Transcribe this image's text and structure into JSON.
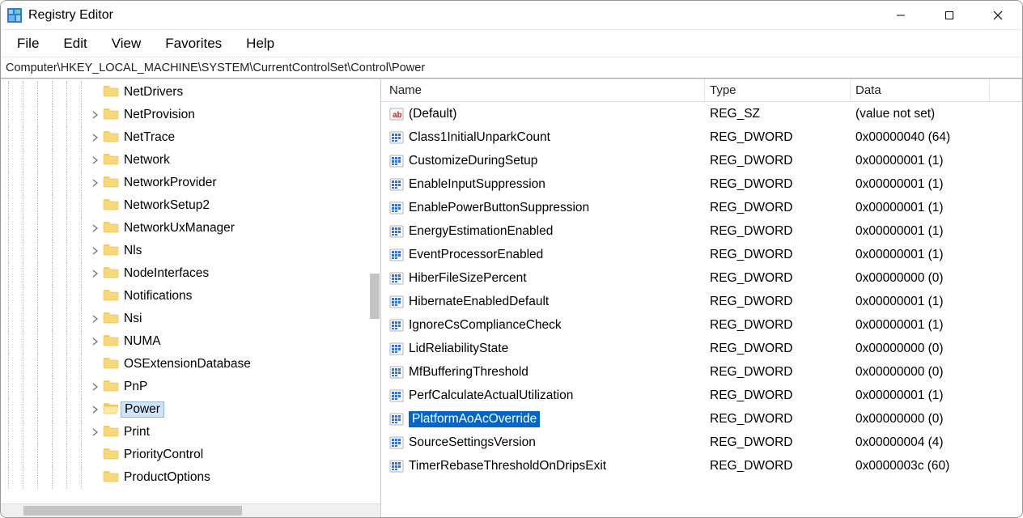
{
  "window": {
    "title": "Registry Editor"
  },
  "menu": {
    "items": [
      "File",
      "Edit",
      "View",
      "Favorites",
      "Help"
    ]
  },
  "address": "Computer\\HKEY_LOCAL_MACHINE\\SYSTEM\\CurrentControlSet\\Control\\Power",
  "columns": {
    "name": "Name",
    "type": "Type",
    "data": "Data"
  },
  "tree": [
    {
      "label": "NetDrivers",
      "depth": 7,
      "expandable": false,
      "selected": false
    },
    {
      "label": "NetProvision",
      "depth": 7,
      "expandable": true,
      "selected": false
    },
    {
      "label": "NetTrace",
      "depth": 7,
      "expandable": true,
      "selected": false
    },
    {
      "label": "Network",
      "depth": 7,
      "expandable": true,
      "selected": false
    },
    {
      "label": "NetworkProvider",
      "depth": 7,
      "expandable": true,
      "selected": false
    },
    {
      "label": "NetworkSetup2",
      "depth": 7,
      "expandable": false,
      "selected": false
    },
    {
      "label": "NetworkUxManager",
      "depth": 7,
      "expandable": true,
      "selected": false
    },
    {
      "label": "Nls",
      "depth": 7,
      "expandable": true,
      "selected": false
    },
    {
      "label": "NodeInterfaces",
      "depth": 7,
      "expandable": true,
      "selected": false
    },
    {
      "label": "Notifications",
      "depth": 7,
      "expandable": false,
      "selected": false
    },
    {
      "label": "Nsi",
      "depth": 7,
      "expandable": true,
      "selected": false
    },
    {
      "label": "NUMA",
      "depth": 7,
      "expandable": true,
      "selected": false
    },
    {
      "label": "OSExtensionDatabase",
      "depth": 7,
      "expandable": false,
      "selected": false
    },
    {
      "label": "PnP",
      "depth": 7,
      "expandable": true,
      "selected": false
    },
    {
      "label": "Power",
      "depth": 7,
      "expandable": true,
      "selected": true
    },
    {
      "label": "Print",
      "depth": 7,
      "expandable": true,
      "selected": false
    },
    {
      "label": "PriorityControl",
      "depth": 7,
      "expandable": false,
      "selected": false
    },
    {
      "label": "ProductOptions",
      "depth": 7,
      "expandable": false,
      "selected": false
    }
  ],
  "values": [
    {
      "name": "(Default)",
      "type": "REG_SZ",
      "data": "(value not set)",
      "kind": "sz",
      "selected": false
    },
    {
      "name": "Class1InitialUnparkCount",
      "type": "REG_DWORD",
      "data": "0x00000040 (64)",
      "kind": "dword",
      "selected": false
    },
    {
      "name": "CustomizeDuringSetup",
      "type": "REG_DWORD",
      "data": "0x00000001 (1)",
      "kind": "dword",
      "selected": false
    },
    {
      "name": "EnableInputSuppression",
      "type": "REG_DWORD",
      "data": "0x00000001 (1)",
      "kind": "dword",
      "selected": false
    },
    {
      "name": "EnablePowerButtonSuppression",
      "type": "REG_DWORD",
      "data": "0x00000001 (1)",
      "kind": "dword",
      "selected": false
    },
    {
      "name": "EnergyEstimationEnabled",
      "type": "REG_DWORD",
      "data": "0x00000001 (1)",
      "kind": "dword",
      "selected": false
    },
    {
      "name": "EventProcessorEnabled",
      "type": "REG_DWORD",
      "data": "0x00000001 (1)",
      "kind": "dword",
      "selected": false
    },
    {
      "name": "HiberFileSizePercent",
      "type": "REG_DWORD",
      "data": "0x00000000 (0)",
      "kind": "dword",
      "selected": false
    },
    {
      "name": "HibernateEnabledDefault",
      "type": "REG_DWORD",
      "data": "0x00000001 (1)",
      "kind": "dword",
      "selected": false
    },
    {
      "name": "IgnoreCsComplianceCheck",
      "type": "REG_DWORD",
      "data": "0x00000001 (1)",
      "kind": "dword",
      "selected": false
    },
    {
      "name": "LidReliabilityState",
      "type": "REG_DWORD",
      "data": "0x00000000 (0)",
      "kind": "dword",
      "selected": false
    },
    {
      "name": "MfBufferingThreshold",
      "type": "REG_DWORD",
      "data": "0x00000000 (0)",
      "kind": "dword",
      "selected": false
    },
    {
      "name": "PerfCalculateActualUtilization",
      "type": "REG_DWORD",
      "data": "0x00000001 (1)",
      "kind": "dword",
      "selected": false
    },
    {
      "name": "PlatformAoAcOverride",
      "type": "REG_DWORD",
      "data": "0x00000000 (0)",
      "kind": "dword",
      "selected": true
    },
    {
      "name": "SourceSettingsVersion",
      "type": "REG_DWORD",
      "data": "0x00000004 (4)",
      "kind": "dword",
      "selected": false
    },
    {
      "name": "TimerRebaseThresholdOnDripsExit",
      "type": "REG_DWORD",
      "data": "0x0000003c (60)",
      "kind": "dword",
      "selected": false
    }
  ]
}
